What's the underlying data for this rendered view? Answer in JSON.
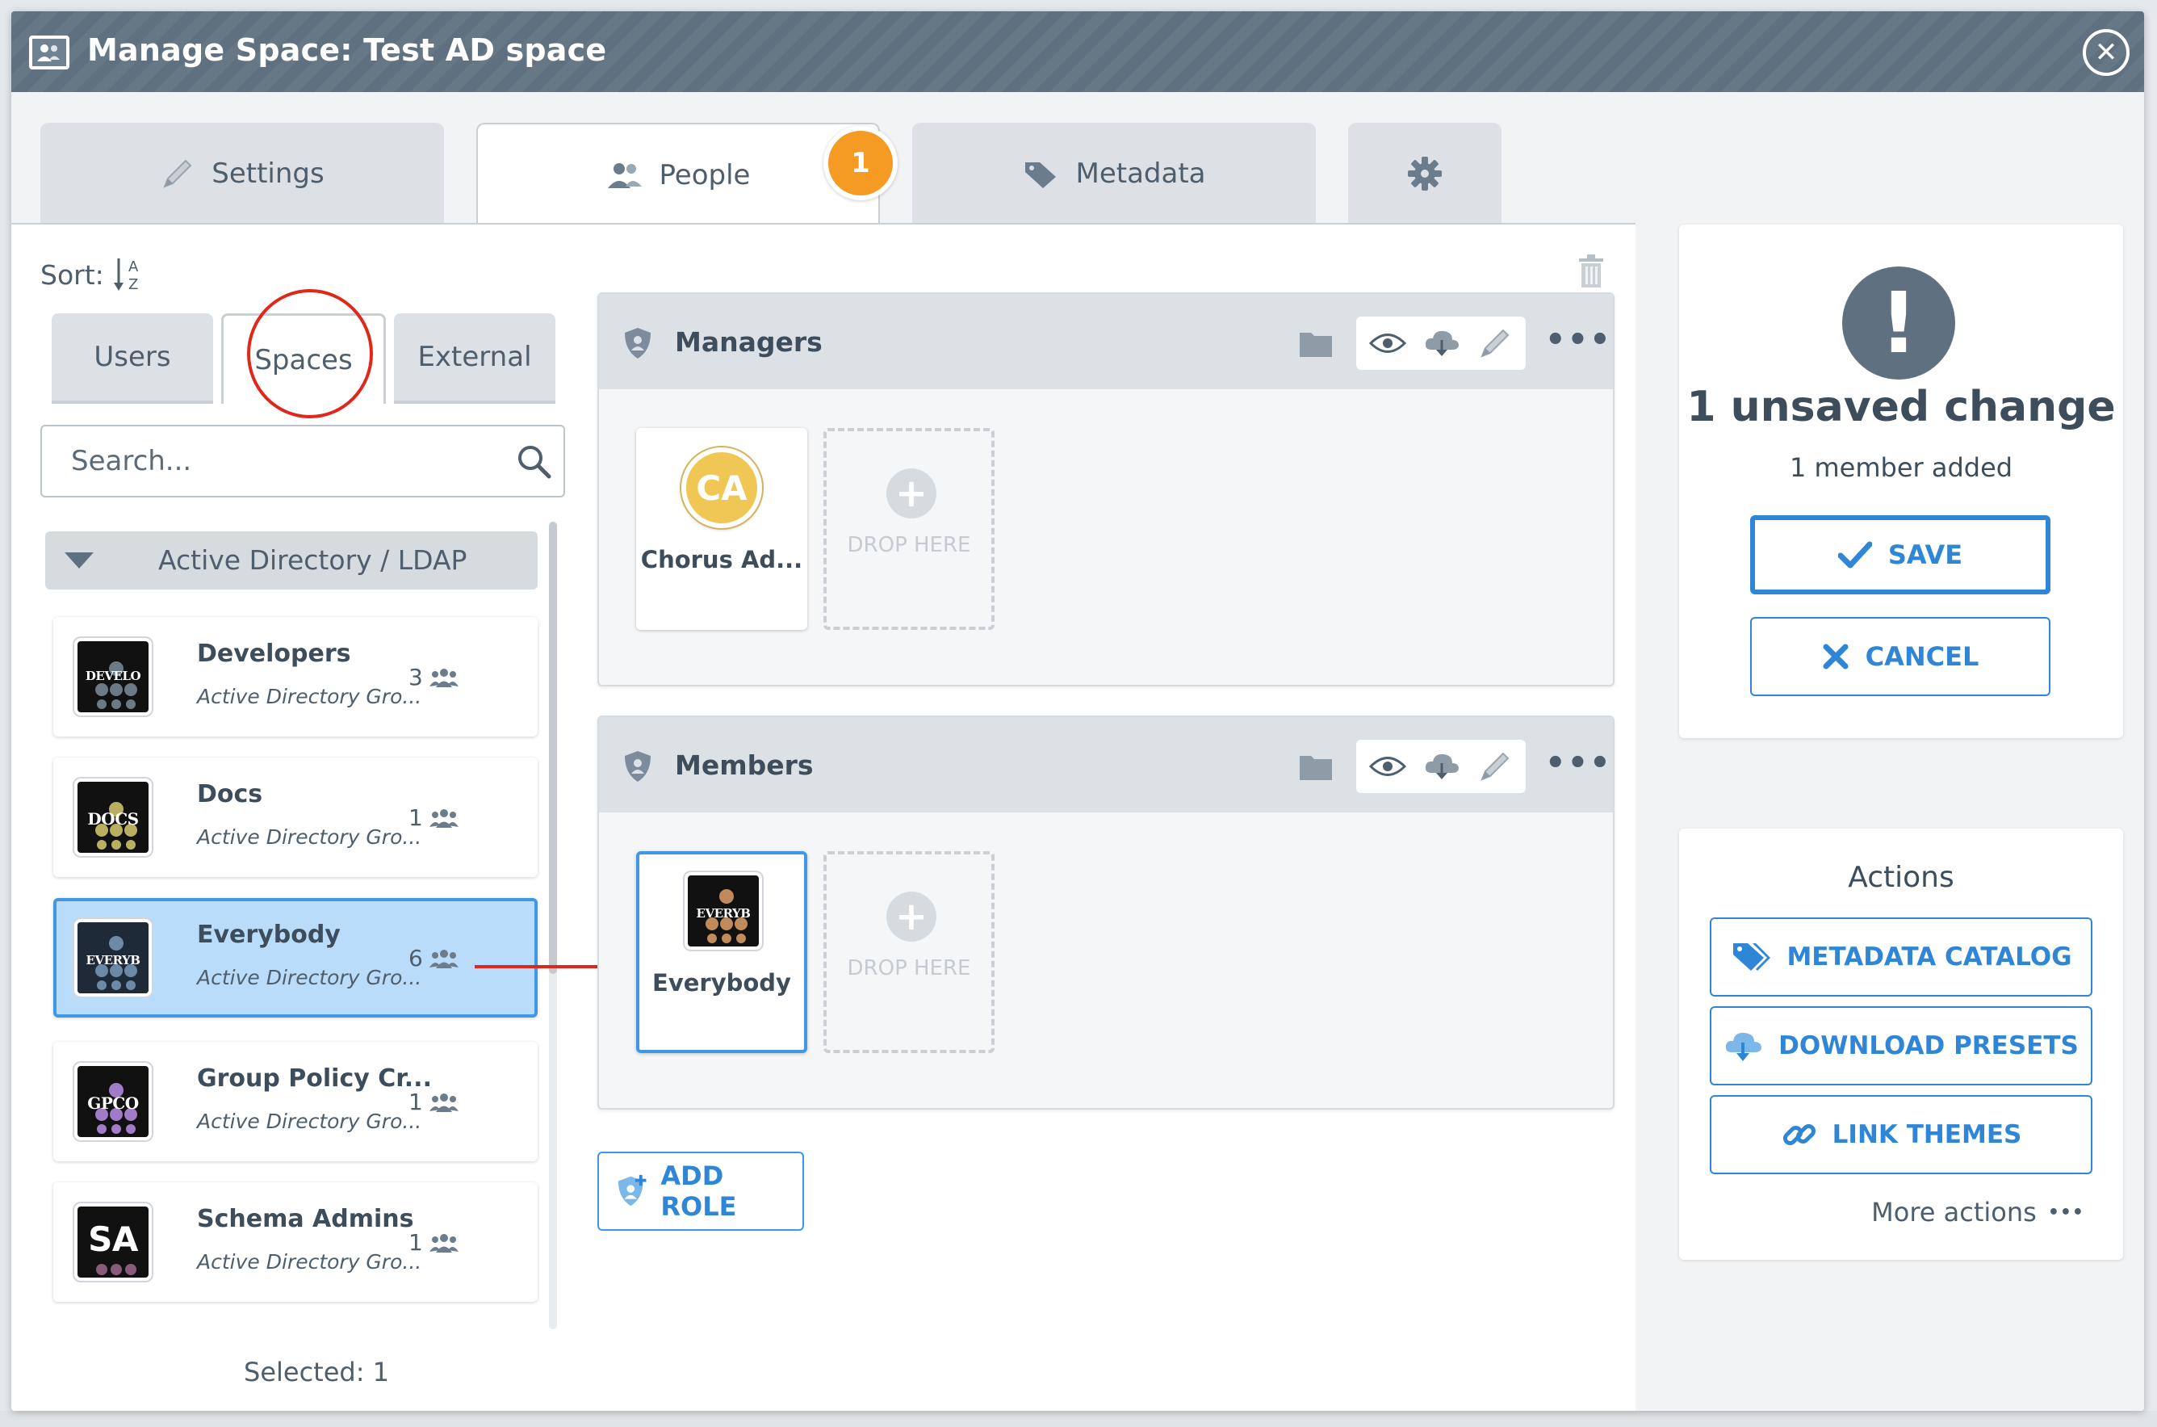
{
  "window": {
    "title": "Manage Space: Test AD space",
    "close_icon": "close-circle-icon"
  },
  "tabs": [
    {
      "label": "Settings",
      "icon": "pencil-icon",
      "active": false
    },
    {
      "label": "People",
      "icon": "users-icon",
      "active": true,
      "badge": "1"
    },
    {
      "label": "Metadata",
      "icon": "tag-icon",
      "active": false
    },
    {
      "label": "",
      "icon": "gear-icon",
      "active": false
    }
  ],
  "people": {
    "sort_label": "Sort:",
    "sort_icon": "sort-az-icon",
    "subtabs": [
      {
        "label": "Users",
        "active": false
      },
      {
        "label": "Spaces",
        "active": true
      },
      {
        "label": "External",
        "active": false
      }
    ],
    "search": {
      "placeholder": "Search...",
      "value": ""
    },
    "group": {
      "label": "Active Directory / LDAP",
      "expanded": true
    },
    "items": [
      {
        "name": "Developers",
        "subtitle": "Active Directory Gro...",
        "count": "3",
        "thumb_text": "DEVELO",
        "thumb_dots": "#6c7a86",
        "selected": false
      },
      {
        "name": "Docs",
        "subtitle": "Active Directory Gro...",
        "count": "1",
        "thumb_text": "DOCS",
        "thumb_dots": "#b8b060",
        "selected": false
      },
      {
        "name": "Everybody",
        "subtitle": "Active Directory Gro...",
        "count": "6",
        "thumb_text": "EVERYB",
        "thumb_dots": "#6c8aa6",
        "selected": true
      },
      {
        "name": "Group Policy Cr...",
        "subtitle": "Active Directory Gro...",
        "count": "1",
        "thumb_text": "GPCO",
        "thumb_dots": "#a07cc8",
        "selected": false
      },
      {
        "name": "Schema Admins",
        "subtitle": "Active Directory Gro...",
        "count": "1",
        "thumb_text": "SA",
        "thumb_dots": "#8a5a7a",
        "selected": false
      }
    ],
    "selected_count": "Selected: 1"
  },
  "roles": [
    {
      "title": "Managers",
      "members": [
        {
          "name": "Chorus Ad...",
          "initials": "CA",
          "type": "user"
        }
      ],
      "drop_label": "DROP HERE"
    },
    {
      "title": "Members",
      "members": [
        {
          "name": "Everybody",
          "thumb_text": "EVERYB",
          "type": "space"
        }
      ],
      "drop_label": "DROP HERE"
    }
  ],
  "add_role_label": "ADD ROLE",
  "unsaved": {
    "title": "1 unsaved change",
    "subtitle": "1 member added",
    "save_label": "SAVE",
    "cancel_label": "CANCEL"
  },
  "actions": {
    "title": "Actions",
    "buttons": [
      {
        "label": "METADATA CATALOG",
        "icon": "tags-icon"
      },
      {
        "label": "DOWNLOAD PRESETS",
        "icon": "cloud-download-icon"
      },
      {
        "label": "LINK THEMES",
        "icon": "link-icon"
      }
    ],
    "more_label": "More actions"
  },
  "colors": {
    "accent": "#2f86d6",
    "badge": "#f59a23",
    "annotation": "#e0271a",
    "titlebar": "#5f7181"
  }
}
